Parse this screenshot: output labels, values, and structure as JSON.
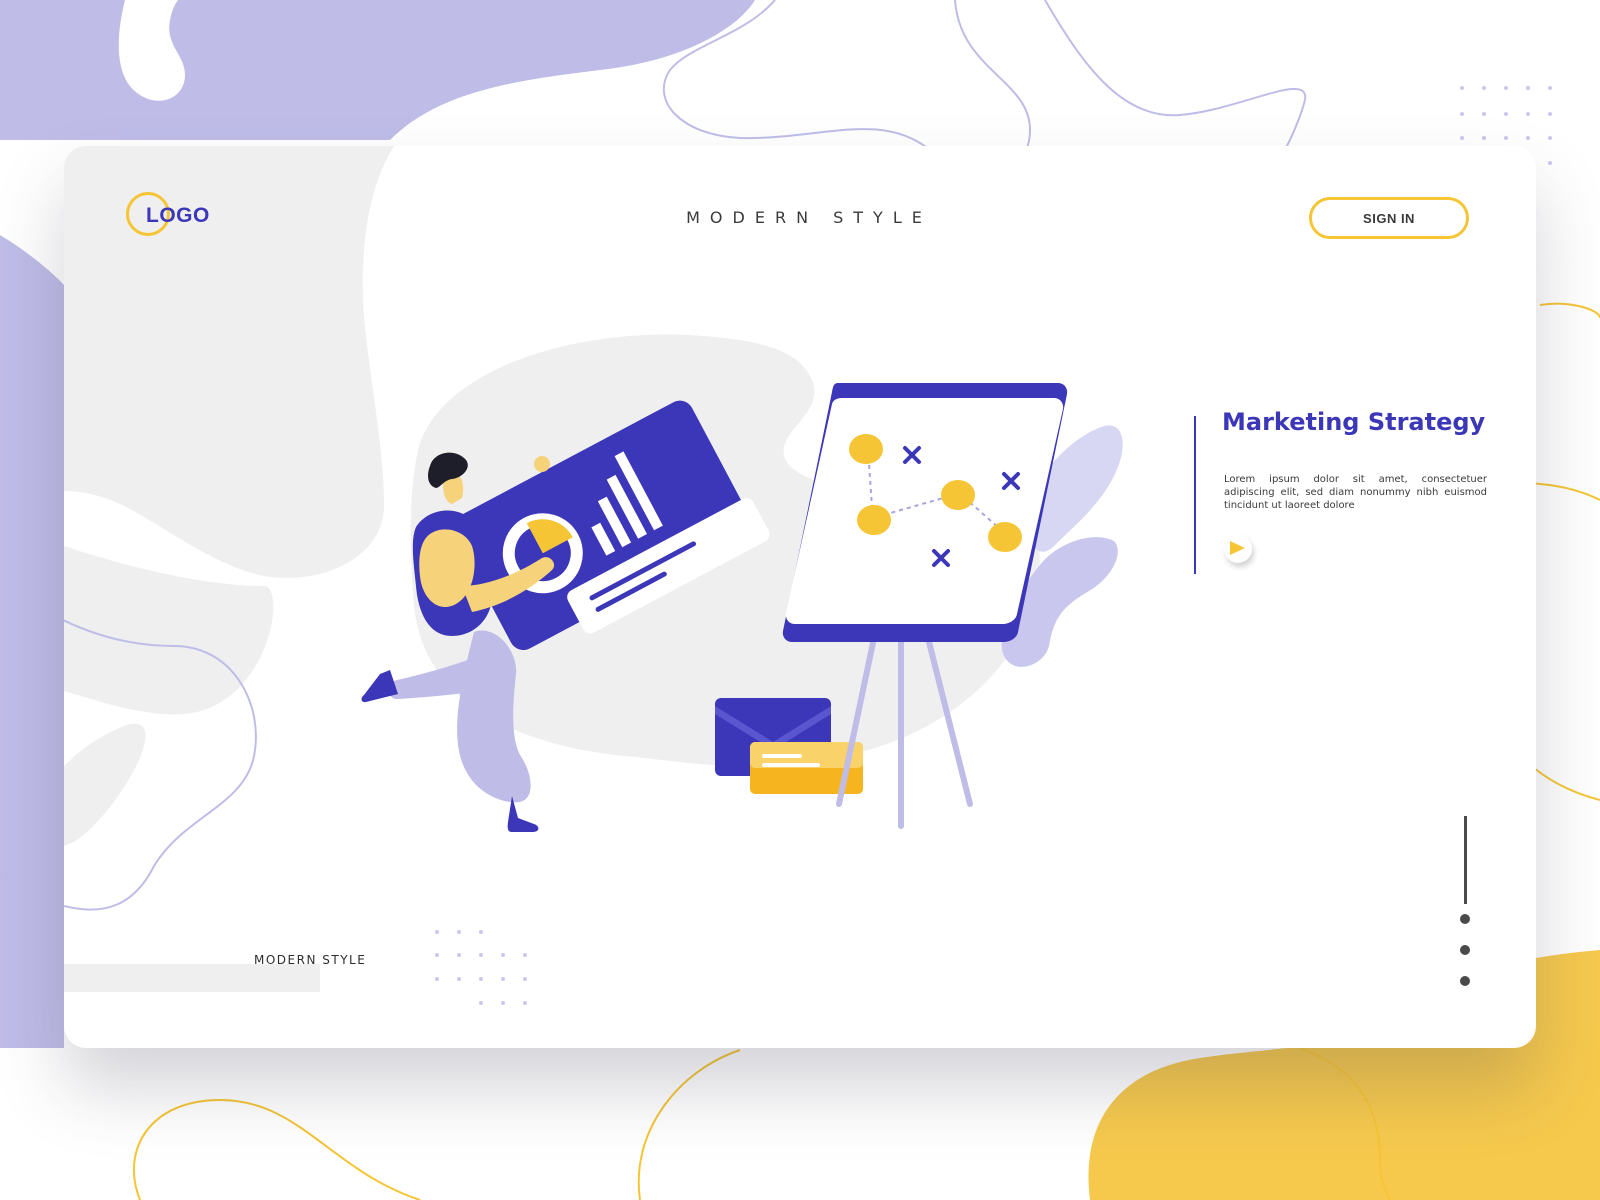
{
  "colors": {
    "accent": "#3b37b8",
    "accent_light": "#bfbde8",
    "secondary": "#f5c536",
    "text": "#3a3a3a",
    "background": "#ffffff",
    "surface": "#efefef"
  },
  "header": {
    "logo_text": "LOGO",
    "title": "MODERN STYLE",
    "signin_label": "SIGN IN"
  },
  "hero": {
    "title": "Marketing Strategy",
    "body": "Lorem ipsum dolor sit amet, consectetuer adipiscing elit, sed diam nonummy nibh euismod tincidunt ut laoreet dolore",
    "play_icon": "play-icon"
  },
  "footer": {
    "label": "MODERN STYLE"
  },
  "slider": {
    "dots_count": 3
  }
}
